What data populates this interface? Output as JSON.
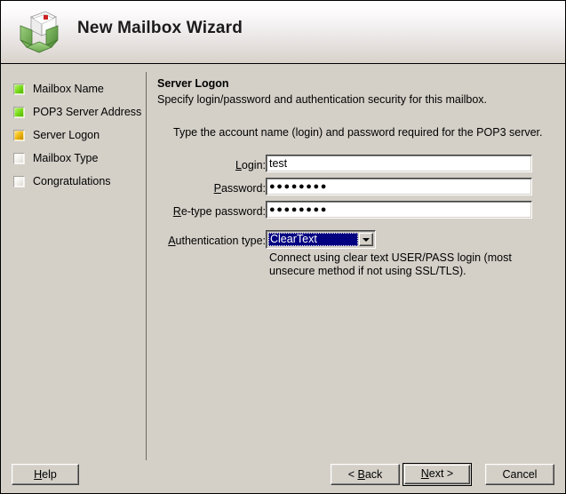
{
  "header": {
    "title": "New Mailbox Wizard",
    "icon": "mailbox-icon"
  },
  "sidebar": {
    "items": [
      {
        "label": "Mailbox Name",
        "state": "done"
      },
      {
        "label": "POP3 Server Address",
        "state": "done"
      },
      {
        "label": "Server Logon",
        "state": "current"
      },
      {
        "label": "Mailbox Type",
        "state": "todo"
      },
      {
        "label": "Congratulations",
        "state": "todo"
      }
    ]
  },
  "main": {
    "title": "Server Logon",
    "subtitle": "Specify login/password and authentication security for this mailbox.",
    "instruction": "Type the account name (login) and password required for the POP3 server.",
    "fields": [
      {
        "label": "Login:",
        "accel": "L",
        "value": "test",
        "type": "text"
      },
      {
        "label": "Password:",
        "accel": "P",
        "value": "●●●●●●●●",
        "type": "password"
      },
      {
        "label": "Re-type password:",
        "accel": "R",
        "value": "●●●●●●●●",
        "type": "password"
      }
    ],
    "auth": {
      "label": "Authentication type:",
      "accel": "A",
      "value": "ClearText",
      "description": "Connect using clear text USER/PASS login (most unsecure method if not using SSL/TLS)."
    }
  },
  "footer": {
    "help": "Help",
    "back": "< Back",
    "next": "Next >",
    "cancel": "Cancel"
  },
  "colors": {
    "face": "#d4d0c8",
    "selection": "#000080",
    "step_done": "#7ede1f",
    "step_current": "#f3bb12",
    "step_todo": "#f3f1ed"
  }
}
